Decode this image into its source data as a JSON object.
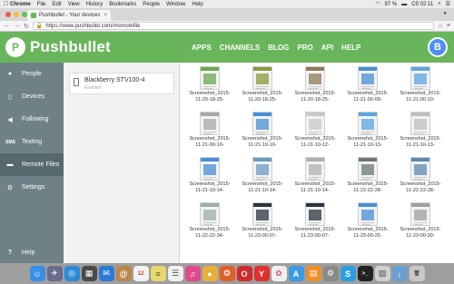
{
  "menubar": {
    "items": [
      "Chrome",
      "File",
      "Edit",
      "View",
      "History",
      "Bookmarks",
      "People",
      "Window",
      "Help"
    ],
    "battery": "97 %",
    "clock": "Cб 02:11"
  },
  "browser": {
    "tab_title": "Pushbullet - Your devices",
    "tab_close": "×",
    "url": "https://www.pushbullet.com/#remotefile",
    "lock_icon": "lock-icon"
  },
  "header": {
    "brand_letter": "P",
    "title": "Pushbullet",
    "nav": [
      "APPS",
      "CHANNELS",
      "BLOG",
      "PRO",
      "API",
      "HELP"
    ],
    "avatar_letter": "B",
    "brand_color": "#69b55b",
    "avatar_color": "#4f8ef7"
  },
  "sidebar": {
    "items": [
      {
        "label": "People",
        "icon": "people-icon"
      },
      {
        "label": "Devices",
        "icon": "phone-icon"
      },
      {
        "label": "Following",
        "icon": "megaphone-icon"
      },
      {
        "label": "Texting",
        "icon": "sms-icon",
        "glyph": "SMS"
      },
      {
        "label": "Remote Files",
        "icon": "folder-icon"
      },
      {
        "label": "Settings",
        "icon": "gear-icon"
      }
    ],
    "active": "Remote Files",
    "help": "Help"
  },
  "devices": [
    {
      "name": "Blackberry STV100-4",
      "status": "Enabled"
    }
  ],
  "files": [
    {
      "line1": "Screenshot_2015-",
      "line2": "11-20-18-25-",
      "tone": "#6aa850"
    },
    {
      "line1": "Screenshot_2015-",
      "line2": "11-20-18-25-",
      "tone": "#8a9a3a"
    },
    {
      "line1": "Screenshot_2015-",
      "line2": "11-20-18-25-",
      "tone": "#8e7a5a"
    },
    {
      "line1": "Screenshot_2015-",
      "line2": "11-21-00-09-",
      "tone": "#4a8fd6"
    },
    {
      "line1": "Screenshot_2015-",
      "line2": "11-21-00-10-",
      "tone": "#5aa5e0"
    },
    {
      "line1": "Screenshot_2015-",
      "line2": "11-21-00-10-",
      "tone": "#a8a8a8"
    },
    {
      "line1": "Screenshot_2015-",
      "line2": "11-21-10-10-",
      "tone": "#4a8fd6"
    },
    {
      "line1": "Screenshot_2015-",
      "line2": "11-21-10-12-",
      "tone": "#c8c8c8"
    },
    {
      "line1": "Screenshot_2015-",
      "line2": "11-21-10-13-",
      "tone": "#5aa5e0"
    },
    {
      "line1": "Screenshot_2015-",
      "line2": "11-21-10-13-",
      "tone": "#bdbdbd"
    },
    {
      "line1": "Screenshot_2015-",
      "line2": "11-21-10-14-",
      "tone": "#4a8fd6"
    },
    {
      "line1": "Screenshot_2015-",
      "line2": "11-21-10-14-",
      "tone": "#6a9ac0"
    },
    {
      "line1": "Screenshot_2015-",
      "line2": "11-21-10-14-",
      "tone": "#b0b0b0"
    },
    {
      "line1": "Screenshot_2015-",
      "line2": "11-22-22-28-",
      "tone": "#6a7a6a"
    },
    {
      "line1": "Screenshot_2015-",
      "line2": "11-22-22-28-",
      "tone": "#5a8ab0"
    },
    {
      "line1": "Screenshot_2015-",
      "line2": "11-22-22-34-",
      "tone": "#9ab0a0"
    },
    {
      "line1": "Screenshot_2015-",
      "line2": "11-23-00-07-",
      "tone": "#2a3440"
    },
    {
      "line1": "Screenshot_2015-",
      "line2": "11-23-00-07-",
      "tone": "#2a3440"
    },
    {
      "line1": "Screenshot_2015-",
      "line2": "11-23-00-25-",
      "tone": "#4a8fd6"
    },
    {
      "line1": "Screenshot_2015-",
      "line2": "11-23-00-30-",
      "tone": "#a0a0a0"
    }
  ],
  "dock": [
    {
      "icon": "finder-icon",
      "color": "#3a8ee6",
      "glyph": "☺"
    },
    {
      "icon": "launchpad-icon",
      "color": "#6a6a8a",
      "glyph": "✈"
    },
    {
      "icon": "safari-icon",
      "color": "#2a8ad6",
      "glyph": "◎"
    },
    {
      "icon": "mission-control-icon",
      "color": "#4a4a4a",
      "glyph": "▦"
    },
    {
      "icon": "mail-icon",
      "color": "#2a7ad6",
      "glyph": "✉"
    },
    {
      "icon": "contacts-icon",
      "color": "#b8874a",
      "glyph": "@"
    },
    {
      "icon": "calendar-icon",
      "color": "#f2f2f2",
      "glyph": "12",
      "text_color": "#d33"
    },
    {
      "icon": "notes-icon",
      "color": "#e8d870",
      "glyph": "≡",
      "text_color": "#6a5a20"
    },
    {
      "icon": "reminders-icon",
      "color": "#f0f0f0",
      "glyph": "☰",
      "text_color": "#555"
    },
    {
      "icon": "itunes-icon",
      "color": "#e04a8a",
      "glyph": "♫"
    },
    {
      "icon": "chrome-icon",
      "color": "#e8b03a",
      "glyph": "●"
    },
    {
      "icon": "firefox-icon",
      "color": "#e0602a",
      "glyph": "❂"
    },
    {
      "icon": "opera-icon",
      "color": "#d02a2a",
      "glyph": "O"
    },
    {
      "icon": "yandex-icon",
      "color": "#e03030",
      "glyph": "Y"
    },
    {
      "icon": "photos-icon",
      "color": "#f0f0f0",
      "glyph": "✿",
      "text_color": "#d05a8a"
    },
    {
      "icon": "app-store-icon",
      "color": "#3a9ae6",
      "glyph": "A"
    },
    {
      "icon": "ibooks-icon",
      "color": "#f0902a",
      "glyph": "▤"
    },
    {
      "icon": "system-prefs-icon",
      "color": "#8a8a8a",
      "glyph": "⚙"
    },
    {
      "icon": "skype-icon",
      "color": "#2aa0e0",
      "glyph": "S"
    },
    {
      "icon": "terminal-icon",
      "color": "#222222",
      "glyph": ">_"
    },
    {
      "icon": "preview-icon",
      "color": "#d0d0d0",
      "glyph": "▨",
      "text_color": "#555"
    },
    {
      "icon": "downloads-icon",
      "color": "#6aa0d0",
      "glyph": "↓"
    },
    {
      "icon": "trash-icon",
      "color": "#c8c8c8",
      "glyph": "🗑",
      "text_color": "#555"
    }
  ]
}
